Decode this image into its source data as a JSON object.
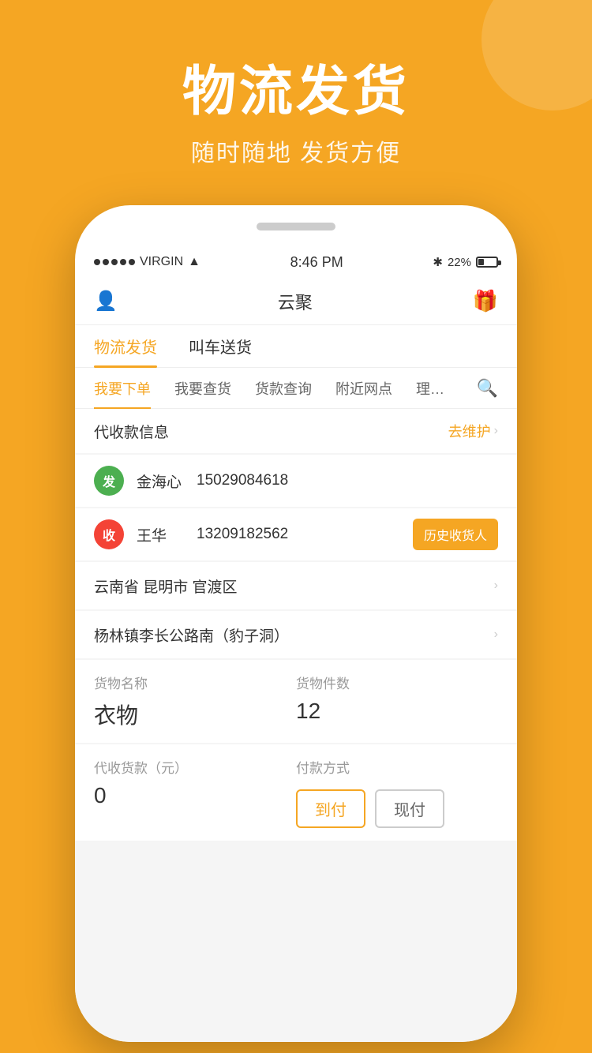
{
  "background": {
    "color": "#F5A623"
  },
  "header": {
    "title": "物流发货",
    "subtitle": "随时随地 发货方便"
  },
  "status_bar": {
    "carrier": "VIRGIN",
    "time": "8:46 PM",
    "bluetooth": "✱",
    "battery_percent": "22%"
  },
  "top_nav": {
    "title": "云聚",
    "left_icon": "person",
    "right_icon": "🎁"
  },
  "tabs": [
    {
      "label": "物流发货",
      "active": true
    },
    {
      "label": "叫车送货",
      "active": false
    }
  ],
  "sub_tabs": [
    {
      "label": "我要下单",
      "active": true
    },
    {
      "label": "我要查货",
      "active": false
    },
    {
      "label": "货款查询",
      "active": false
    },
    {
      "label": "附近网点",
      "active": false
    },
    {
      "label": "理…",
      "active": false
    }
  ],
  "collection_info": {
    "title": "代收款信息",
    "action": "去维护"
  },
  "sender": {
    "badge": "发",
    "name": "金海心",
    "phone": "15029084618",
    "badge_color": "green"
  },
  "receiver": {
    "badge": "收",
    "name": "王华",
    "phone": "13209182562",
    "badge_color": "red",
    "history_btn": "历史收货人"
  },
  "address_province": "云南省 昆明市 官渡区",
  "address_detail": "杨林镇李长公路南（豹子洞）",
  "goods": {
    "name_label": "货物名称",
    "name_value": "衣物",
    "count_label": "货物件数",
    "count_value": "12"
  },
  "payment": {
    "cod_label": "代收货款（元）",
    "cod_value": "0",
    "method_label": "付款方式",
    "methods": [
      {
        "label": "到付",
        "active": true
      },
      {
        "label": "现付",
        "active": false
      }
    ]
  }
}
